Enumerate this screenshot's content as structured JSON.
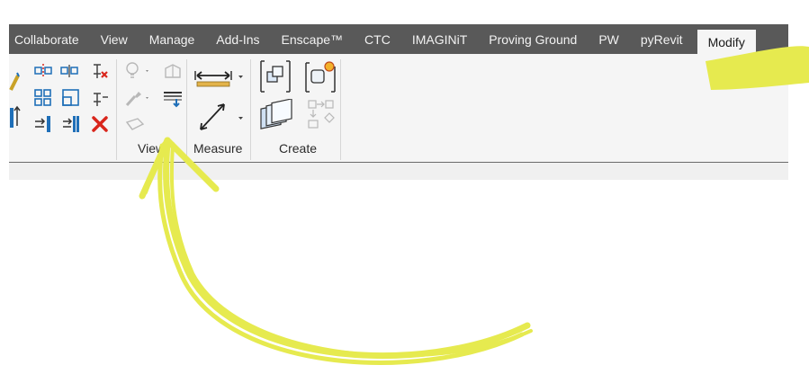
{
  "tabs": [
    {
      "label": "Collaborate"
    },
    {
      "label": "View"
    },
    {
      "label": "Manage"
    },
    {
      "label": "Add-Ins"
    },
    {
      "label": "Enscape™"
    },
    {
      "label": "CTC"
    },
    {
      "label": "IMAGINiT"
    },
    {
      "label": "Proving Ground"
    },
    {
      "label": "PW"
    },
    {
      "label": "pyRevit"
    },
    {
      "label": "Modify"
    }
  ],
  "active_tab": "Modify",
  "panels": {
    "view_label": "View",
    "measure_label": "Measure",
    "create_label": "Create"
  },
  "colors": {
    "tabbar": "#595959",
    "ribbon": "#f5f5f5",
    "annotation": "#e6ea4f",
    "icon_blue": "#1f6fb8",
    "delete_red": "#d9261c"
  }
}
